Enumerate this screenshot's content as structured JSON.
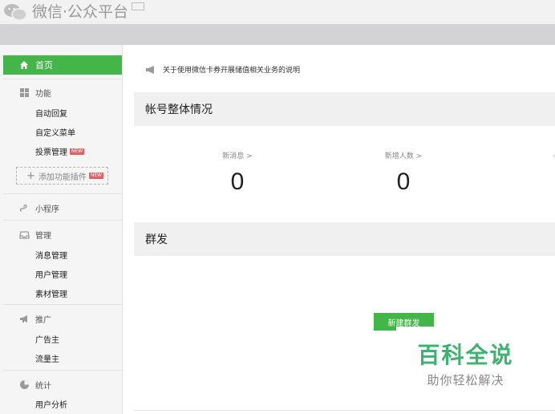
{
  "header": {
    "logo_text": "微信·公众平台"
  },
  "sidebar": {
    "home": "首页",
    "features": {
      "title": "功能",
      "items": [
        "自定义菜单",
        "投票管理"
      ],
      "auto_reply": "自动回复",
      "new_tag": "NEW"
    },
    "add_plugin": "添加功能插件",
    "mini_program": "小程序",
    "manage": {
      "title": "管理",
      "items": [
        "消息管理",
        "用户管理",
        "素材管理"
      ]
    },
    "promote": {
      "title": "推广",
      "items": [
        "广告主",
        "流量主"
      ]
    },
    "stats": {
      "title": "统计",
      "items": [
        "用户分析"
      ]
    }
  },
  "main": {
    "notice": "关于使用微信卡券开展储值相关业务的说明",
    "account_overview_title": "帐号整体情况",
    "stats": [
      {
        "label": "新消息 >",
        "value": "0"
      },
      {
        "label": "新增人数 >",
        "value": "0"
      }
    ],
    "mass_send_title": "群发",
    "new_mass_button": "新建群发"
  },
  "watermark": {
    "main": "百科全说",
    "sub": "助你轻松解决"
  },
  "colors": {
    "accent_green": "#44b549",
    "new_tag_red": "#e15f63",
    "watermark_green": "#3cb371"
  }
}
